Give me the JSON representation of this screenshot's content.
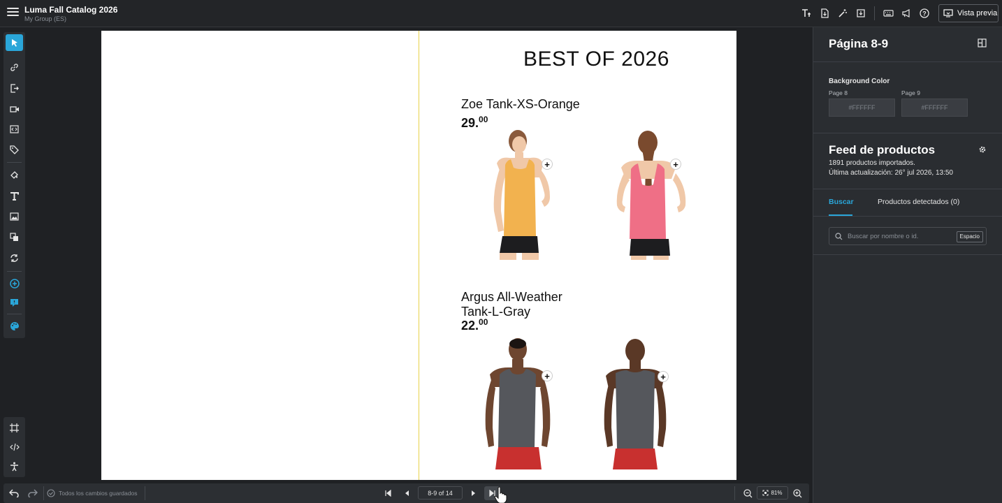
{
  "app": {
    "title": "Luma Fall Catalog 2026",
    "subtitle": "My Group (ES)"
  },
  "toolbar": {
    "icons": [
      "text-format-icon",
      "document-export-icon",
      "magic-wand-icon",
      "download-icon",
      "keyboard-icon",
      "megaphone-icon",
      "help-icon"
    ],
    "preview_label": "Vista previa"
  },
  "tools": [
    "select-tool",
    "link-tool",
    "page-link-tool",
    "video-tool",
    "embed-tool",
    "tag-tool",
    "fill-tool",
    "text-tool",
    "image-tool",
    "layers-tool",
    "replace-tool",
    "add-tool",
    "comment-tool",
    "palette-tool"
  ],
  "canvas": {
    "heading": "BEST OF 2026",
    "products": [
      {
        "name": "Zoe Tank-XS-Orange",
        "price_int": "29.",
        "price_dec": "00"
      },
      {
        "name_line1": "Argus All-Weather",
        "name_line2": "Tank-L-Gray",
        "price_int": "22.",
        "price_dec": "00"
      }
    ],
    "plus_symbol": "+"
  },
  "panel": {
    "title": "Página 8-9",
    "bg_label": "Background Color",
    "page_a_label": "Page 8",
    "page_a_value": "#FFFFFF",
    "page_b_label": "Page 9",
    "page_b_value": "#FFFFFF",
    "feed_title": "Feed de productos",
    "feed_count": "1891 productos importados.",
    "feed_updated": "Última actualización: 26° jul 2026, 13:50",
    "tab_search": "Buscar",
    "tab_detected": "Productos detectados (0)",
    "search_placeholder": "Buscar por nombre o id.",
    "search_key": "Espacio"
  },
  "bottom": {
    "saved": "Todos los cambios guardados",
    "page_indicator": "8-9 of 14",
    "zoom": "81%"
  },
  "colors": {
    "accent": "#2aa6d9",
    "spine": "#e8d24a",
    "orange_tank": "#f2b24f",
    "pink_tank": "#ef6f86",
    "gray_tank": "#55575c",
    "red_shorts": "#c8302f"
  }
}
